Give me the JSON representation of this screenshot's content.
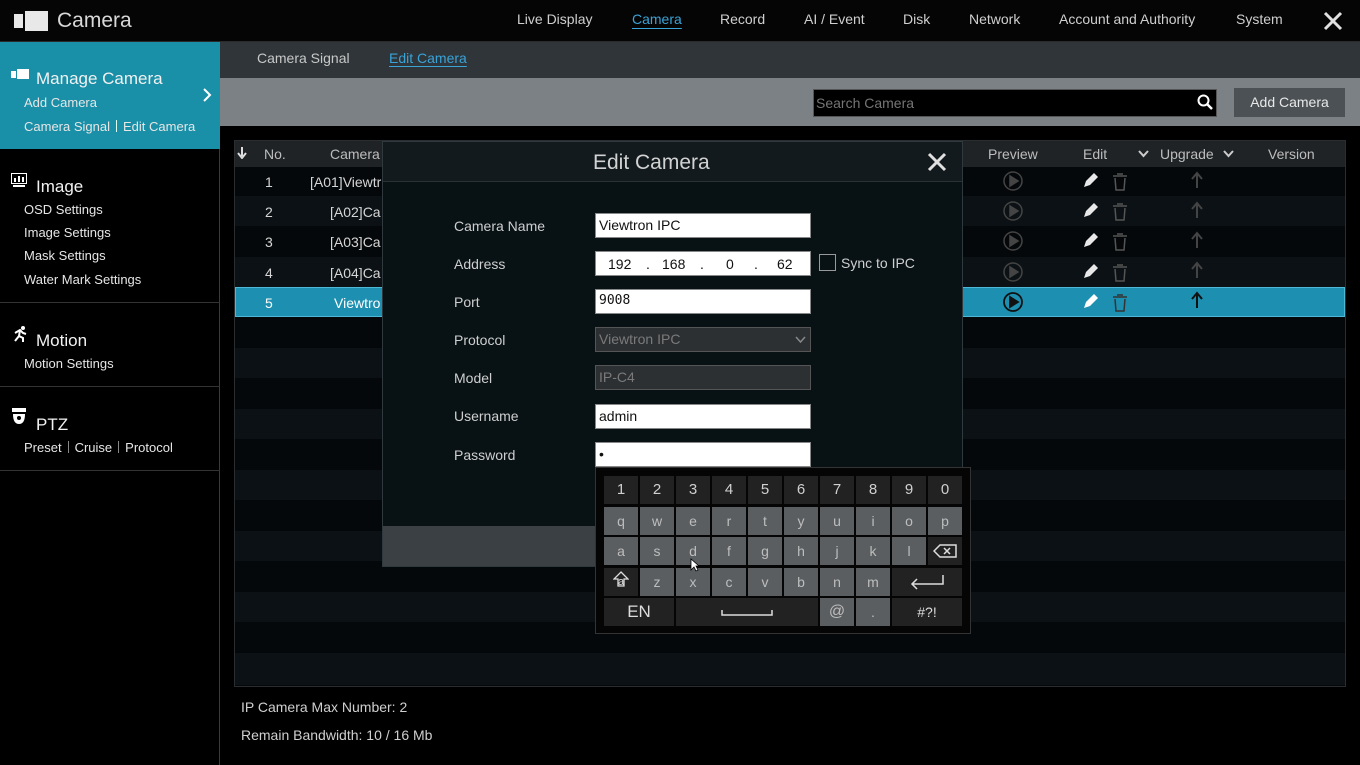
{
  "app": {
    "title": "Camera"
  },
  "top_nav": [
    {
      "label": "Live Display"
    },
    {
      "label": "Camera",
      "active": true
    },
    {
      "label": "Record"
    },
    {
      "label": "AI / Event"
    },
    {
      "label": "Disk"
    },
    {
      "label": "Network"
    },
    {
      "label": "Account and Authority"
    },
    {
      "label": "System"
    }
  ],
  "sidebar": {
    "manage": {
      "title": "Manage Camera",
      "items": [
        "Add Camera",
        "Camera Signal",
        "Edit Camera"
      ]
    },
    "image": {
      "title": "Image",
      "items": [
        "OSD Settings",
        "Image Settings",
        "Mask Settings",
        "Water Mark Settings"
      ]
    },
    "motion": {
      "title": "Motion",
      "items": [
        "Motion Settings"
      ]
    },
    "ptz": {
      "title": "PTZ",
      "items": [
        "Preset",
        "Cruise",
        "Protocol"
      ]
    }
  },
  "sub_tabs": [
    {
      "label": "Camera Signal"
    },
    {
      "label": "Edit Camera",
      "active": true
    }
  ],
  "search": {
    "placeholder": "Search Camera"
  },
  "add_camera_label": "Add Camera",
  "table": {
    "headers": {
      "no": "No.",
      "camera": "Camera",
      "preview": "Preview",
      "edit": "Edit",
      "upgrade": "Upgrade",
      "version": "Version"
    },
    "rows": [
      {
        "no": "1",
        "camera": "[A01]Viewtr"
      },
      {
        "no": "2",
        "camera": "[A02]Ca"
      },
      {
        "no": "3",
        "camera": "[A03]Ca"
      },
      {
        "no": "4",
        "camera": "[A04]Ca"
      },
      {
        "no": "5",
        "camera": "Viewtro",
        "selected": true
      }
    ]
  },
  "footer": {
    "max_number": "IP Camera Max Number: 2",
    "bandwidth": "Remain Bandwidth: 10 / 16 Mb"
  },
  "dialog": {
    "title": "Edit Camera",
    "labels": {
      "camera_name": "Camera Name",
      "address": "Address",
      "port": "Port",
      "protocol": "Protocol",
      "model": "Model",
      "username": "Username",
      "password": "Password"
    },
    "values": {
      "camera_name": "Viewtron IPC",
      "ip": [
        "192",
        "168",
        "0",
        "62"
      ],
      "port": "9008",
      "protocol": "Viewtron IPC",
      "model": "IP-C4",
      "username": "admin",
      "password": "•"
    },
    "sync_label": "Sync to IPC"
  },
  "keyboard": {
    "row1": [
      "1",
      "2",
      "3",
      "4",
      "5",
      "6",
      "7",
      "8",
      "9",
      "0"
    ],
    "row2": [
      "q",
      "w",
      "e",
      "r",
      "t",
      "y",
      "u",
      "i",
      "o",
      "p"
    ],
    "row3": [
      "a",
      "s",
      "d",
      "f",
      "g",
      "h",
      "j",
      "k",
      "l"
    ],
    "row4": [
      "z",
      "x",
      "c",
      "v",
      "b",
      "n",
      "m"
    ],
    "lang": "EN",
    "at": "@",
    "dot": ".",
    "symbols": "#?!",
    "shift_sub": "a"
  }
}
